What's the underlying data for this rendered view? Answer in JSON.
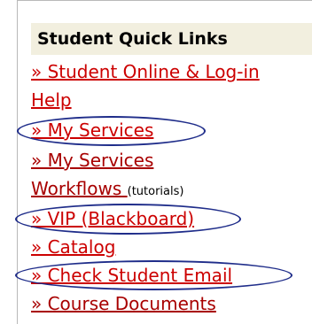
{
  "panel": {
    "title": "Student Quick Links"
  },
  "links": {
    "student_online_line1": "» Student Online & Log-in",
    "student_online_line2": "Help",
    "my_services": "» My Services",
    "my_services_workflows_line1": "» My Services",
    "my_services_workflows_line2": "Workflows",
    "tutorials": "(tutorials)",
    "vip": "» VIP (Blackboard)",
    "catalog": "» Catalog",
    "check_email": "» Check Student Email",
    "course_documents": "» Course Documents"
  },
  "colors": {
    "link": "#cc0000",
    "header_bg": "#f2efdf",
    "highlight_oval": "#1f2d8a"
  }
}
